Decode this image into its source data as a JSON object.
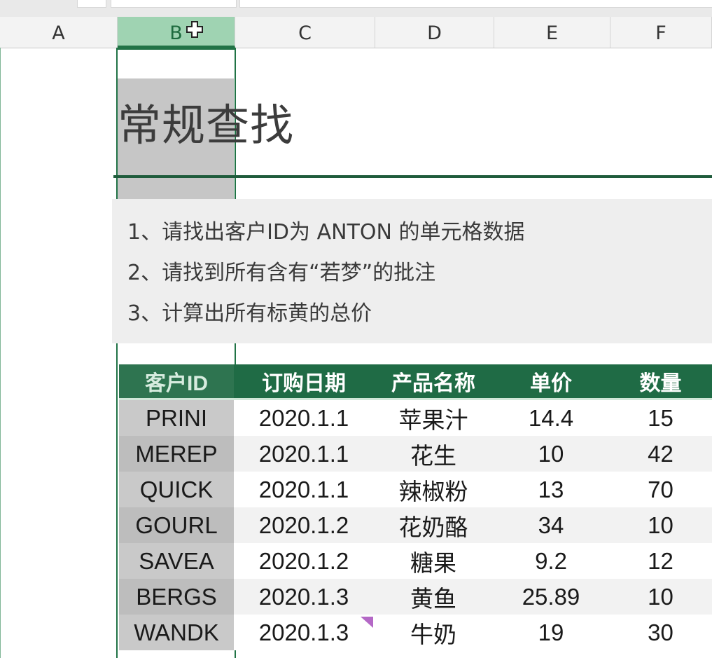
{
  "columns": [
    "A",
    "B",
    "C",
    "D",
    "E",
    "F"
  ],
  "selected_column": "B",
  "title": "常规查找",
  "instructions": [
    "1、请找出客户ID为 ANTON 的单元格数据",
    "2、请找到所有含有“若梦”的批注",
    "3、计算出所有标黄的总价"
  ],
  "table": {
    "headers": [
      "客户ID",
      "订购日期",
      "产品名称",
      "单价",
      "数量"
    ],
    "rows": [
      [
        "PRINI",
        "2020.1.1",
        "苹果汁",
        "14.4",
        "15"
      ],
      [
        "MEREP",
        "2020.1.1",
        "花生",
        "10",
        "42"
      ],
      [
        "QUICK",
        "2020.1.1",
        "辣椒粉",
        "13",
        "70"
      ],
      [
        "GOURL",
        "2020.1.2",
        "花奶酪",
        "34",
        "10"
      ],
      [
        "SAVEA",
        "2020.1.2",
        "糖果",
        "9.2",
        "12"
      ],
      [
        "BERGS",
        "2020.1.3",
        "黄鱼",
        "25.89",
        "10"
      ],
      [
        "WANDK",
        "2020.1.3",
        "牛奶",
        "19",
        "30"
      ]
    ]
  },
  "colors": {
    "header_green": "#1f6b45",
    "selection_green": "#217346",
    "selected_header": "#9fd3b2",
    "comment_indicator": "#b468c6"
  },
  "icons": {
    "cursor": "plus-cursor-icon",
    "comment": "comment-indicator-icon"
  }
}
